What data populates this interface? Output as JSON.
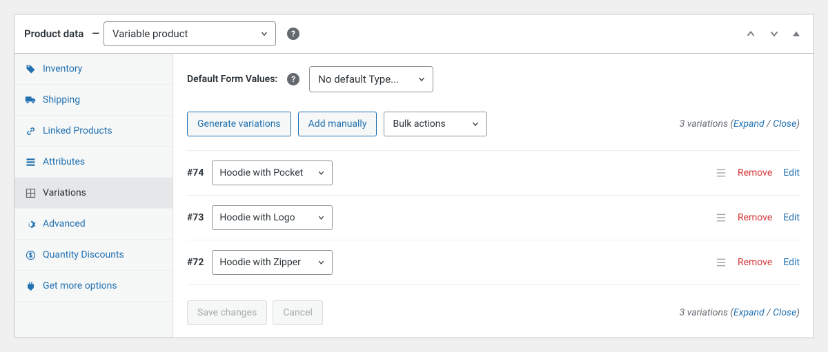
{
  "header": {
    "title": "Product data",
    "separator": "—",
    "product_type": "Variable product",
    "help": "?"
  },
  "tabs": [
    {
      "label": "Inventory"
    },
    {
      "label": "Shipping"
    },
    {
      "label": "Linked Products"
    },
    {
      "label": "Attributes"
    },
    {
      "label": "Variations"
    },
    {
      "label": "Advanced"
    },
    {
      "label": "Quantity Discounts"
    },
    {
      "label": "Get more options"
    }
  ],
  "content": {
    "default_form_label": "Default Form Values:",
    "default_form_select": "No default Type...",
    "generate_btn": "Generate variations",
    "add_manually_btn": "Add manually",
    "bulk_actions": "Bulk actions",
    "variations": [
      {
        "id": "#74",
        "value": "Hoodie with Pocket"
      },
      {
        "id": "#73",
        "value": "Hoodie with Logo"
      },
      {
        "id": "#72",
        "value": "Hoodie with Zipper"
      }
    ],
    "remove_label": "Remove",
    "edit_label": "Edit",
    "save_label": "Save changes",
    "cancel_label": "Cancel",
    "summary_count": "3 variations",
    "expand_label": "Expand",
    "close_label": "Close"
  }
}
